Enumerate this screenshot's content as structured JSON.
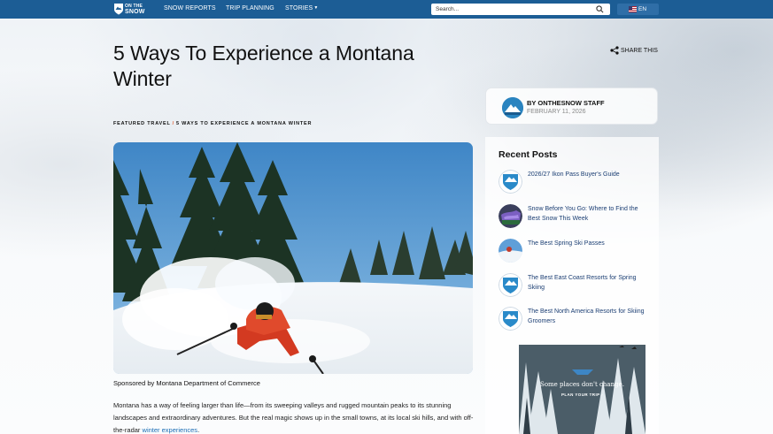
{
  "nav": {
    "logo_text_line1": "ON THE",
    "logo_text_line2": "SNOW",
    "links": [
      "SNOW REPORTS",
      "TRIP PLANNING",
      "STORIES"
    ],
    "search_placeholder": "Search...",
    "language": "EN"
  },
  "article": {
    "title": "5 Ways To Experience a Montana Winter",
    "share_label": "SHARE THIS",
    "author": "BY ONTHESNOW STAFF",
    "date": "FEBRUARY 11, 2026",
    "breadcrumb_section": "FEATURED TRAVEL",
    "breadcrumb_separator": "/",
    "breadcrumb_current": "5 WAYS TO EXPERIENCE A MONTANA WINTER",
    "caption": "Sponsored by Montana Department of Commerce",
    "body_intro": "Montana has a way of feeling larger than life—from its sweeping valleys and rugged mountain peaks to its stunning landscapes and extraordinary adventures. But the real magic shows up in the small towns, at its local ski hills, and with off-the-radar ",
    "body_link": "winter experiences",
    "body_end": "."
  },
  "sidebar": {
    "recent_title": "Recent Posts",
    "posts": [
      {
        "title": "2026/27 Ikon Pass Buyer's Guide"
      },
      {
        "title": "Snow Before You Go: Where to Find the Best Snow This Week"
      },
      {
        "title": "The Best Spring Ski Passes"
      },
      {
        "title": "The Best East Coast Resorts for Spring Skiing"
      },
      {
        "title": "The Best North America Resorts for Skiing Groomers"
      }
    ],
    "ad_text": "Some places don't change.",
    "ad_cta": "PLAN YOUR TRIP"
  },
  "colors": {
    "nav_bg": "#1c5d95",
    "link": "#1c6eb5",
    "post_title": "#1b3e73",
    "breadcrumb_sep": "#e05a2b"
  }
}
